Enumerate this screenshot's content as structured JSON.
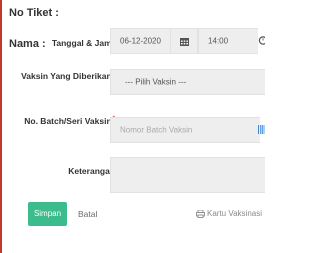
{
  "header": {
    "no_tiket_label": "No Tiket :",
    "nama_label": "Nama :"
  },
  "form": {
    "tanggal_jam": {
      "label": "Tanggal & Jam",
      "date_value": "06-12-2020",
      "time_value": "14:00"
    },
    "vaksin": {
      "label": "Vaksin Yang Diberikan",
      "selected": "--- Pilih Vaksin ---"
    },
    "batch": {
      "label": "No. Batch/Seri Vaksin",
      "placeholder": "Nomor Batch Vaksin",
      "value": ""
    },
    "keterangan": {
      "label": "Keterangan",
      "value": ""
    },
    "required_marker": "*"
  },
  "actions": {
    "save_label": "Simpan",
    "cancel_label": "Batal",
    "card_label": "Kartu Vaksinasi"
  },
  "icons": {
    "calendar": "calendar-icon",
    "clock": "clock-icon",
    "barcode": "barcode-icon",
    "print": "print-icon"
  },
  "colors": {
    "primary": "#3cbc8d",
    "accent_border": "#c0392b",
    "required": "#e74c3c",
    "field_bg": "#eeeeee"
  }
}
